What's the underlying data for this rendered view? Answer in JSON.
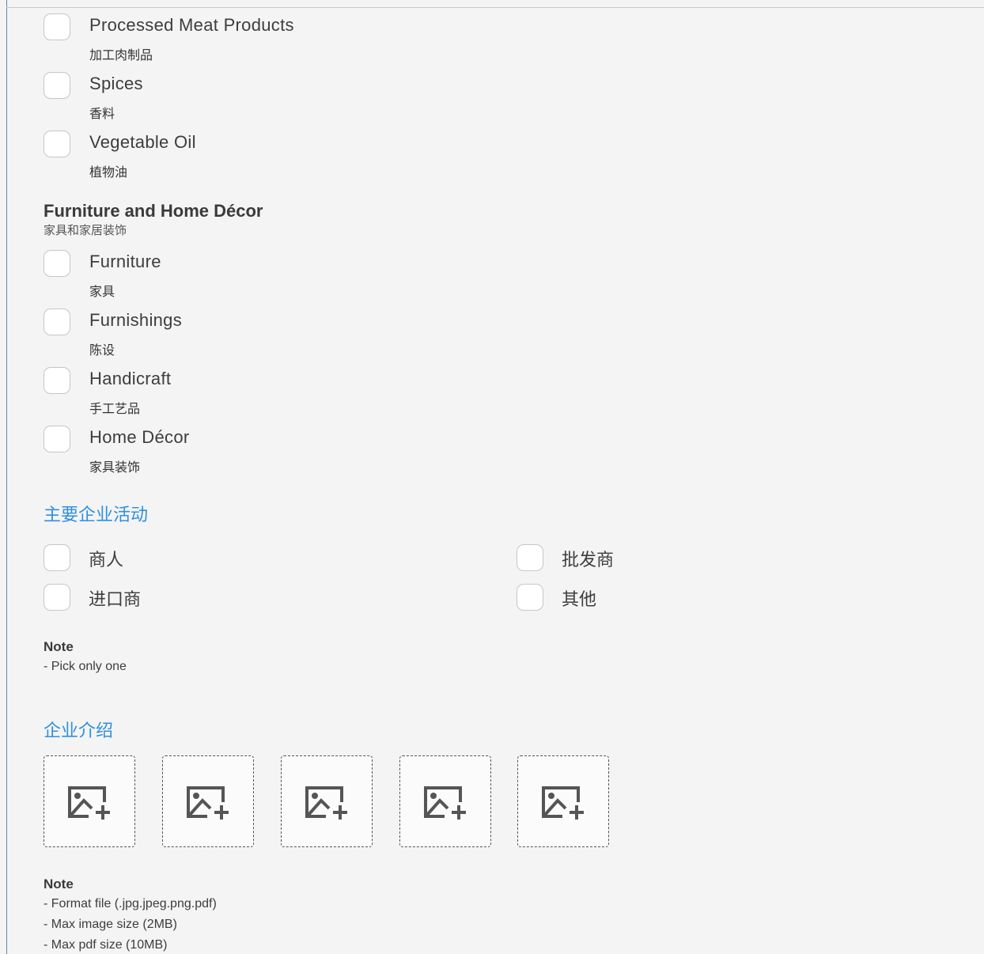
{
  "food_items": [
    {
      "label": "Processed Meat Products",
      "sub": "加工肉制品"
    },
    {
      "label": "Spices",
      "sub": "香料"
    },
    {
      "label": "Vegetable Oil",
      "sub": "植物油"
    }
  ],
  "furniture_category": {
    "title": "Furniture and Home Décor",
    "sub": "家具和家居装饰",
    "items": [
      {
        "label": "Furniture",
        "sub": "家具"
      },
      {
        "label": "Furnishings",
        "sub": "陈设"
      },
      {
        "label": "Handicraft",
        "sub": "手工艺品"
      },
      {
        "label": "Home Décor",
        "sub": "家具装饰"
      }
    ]
  },
  "main_activity": {
    "title": "主要企业活动",
    "options": [
      "商人",
      "批发商",
      "进口商",
      "其他"
    ],
    "note_title": "Note",
    "note_lines": [
      "- Pick only one"
    ]
  },
  "company_intro": {
    "title": "企业介绍",
    "upload_icon": "add-image-icon",
    "note_title": "Note",
    "note_lines": [
      "- Format file (.jpg.jpeg.png.pdf)",
      "- Max image size (2MB)",
      "- Max pdf size (10MB)"
    ]
  }
}
